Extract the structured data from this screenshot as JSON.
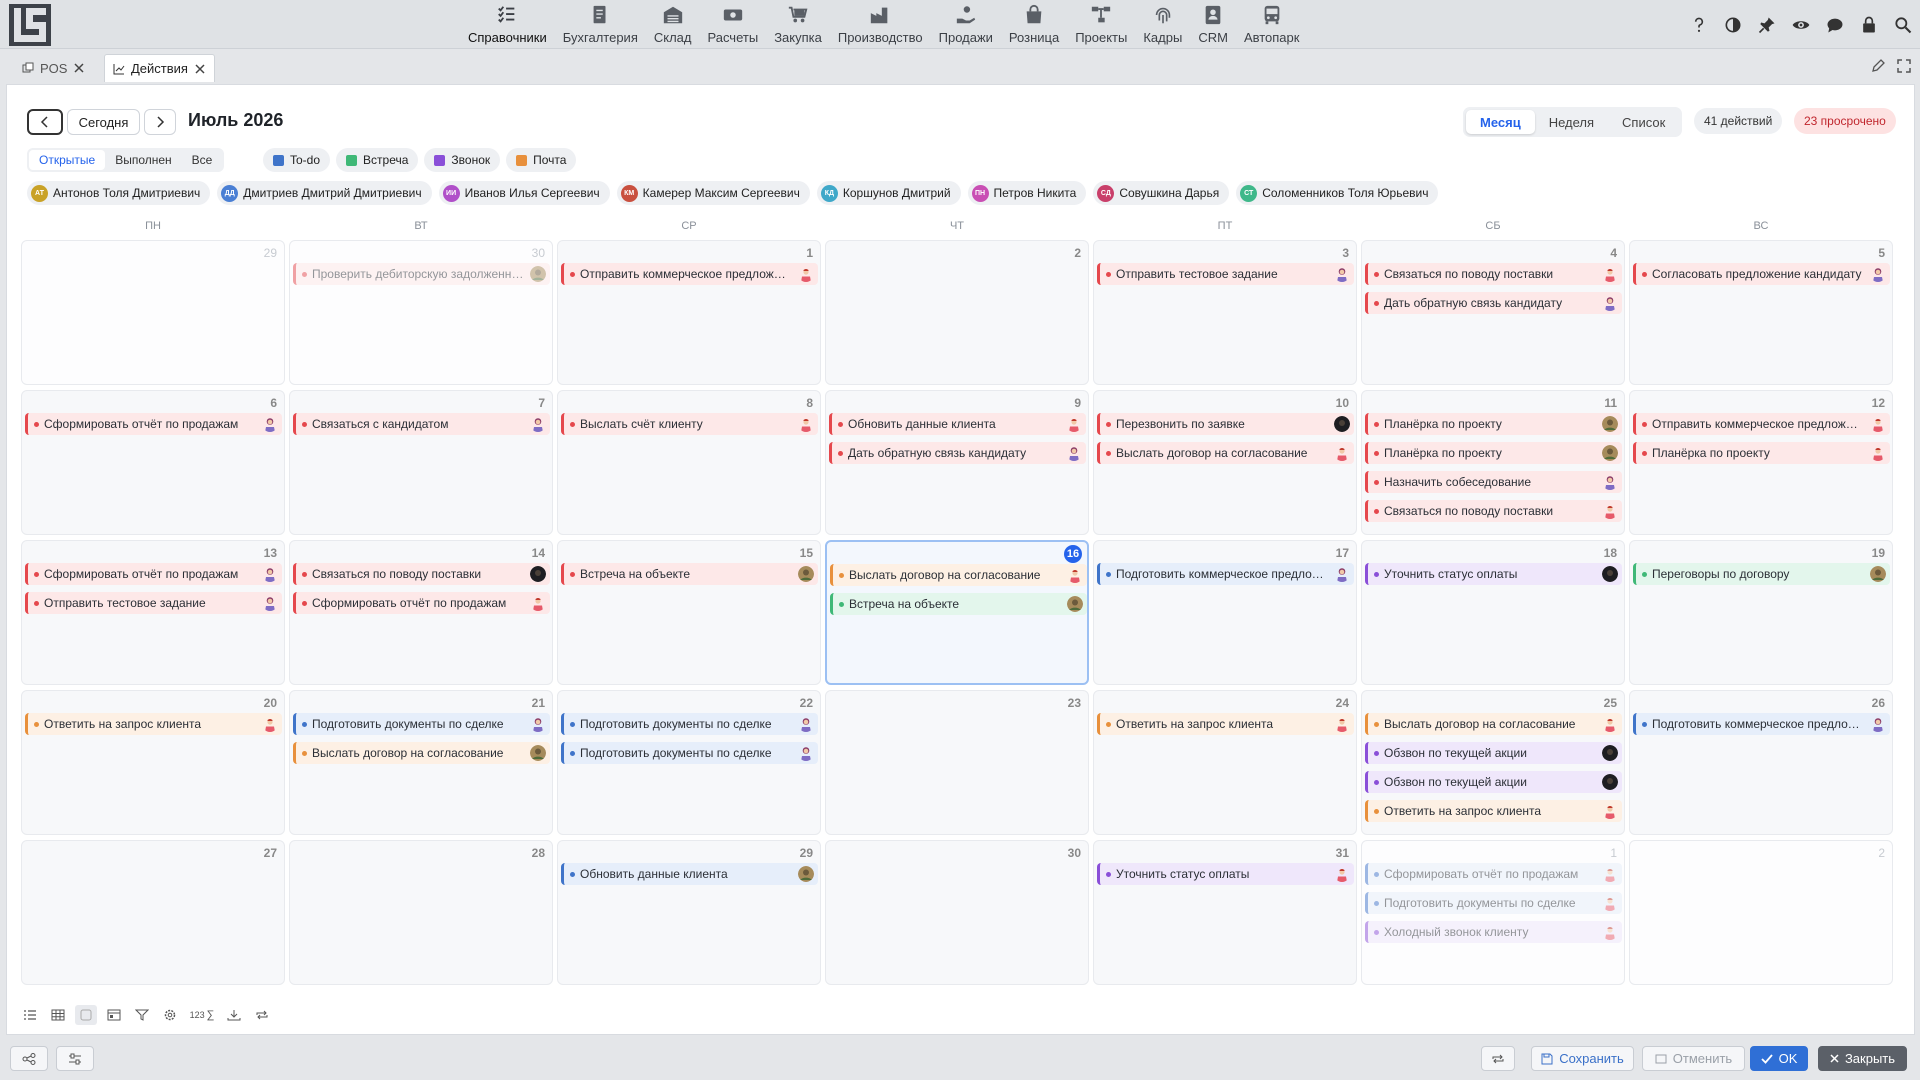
{
  "nav": [
    {
      "label": "Справочники",
      "icon": "list-check-icon"
    },
    {
      "label": "Бухгалтерия",
      "icon": "ledger-icon"
    },
    {
      "label": "Склад",
      "icon": "warehouse-icon"
    },
    {
      "label": "Расчеты",
      "icon": "money-icon"
    },
    {
      "label": "Закупка",
      "icon": "cart-icon"
    },
    {
      "label": "Производство",
      "icon": "factory-icon"
    },
    {
      "label": "Продажи",
      "icon": "hand-coin-icon"
    },
    {
      "label": "Розница",
      "icon": "shopping-bag-icon"
    },
    {
      "label": "Проекты",
      "icon": "project-tree-icon"
    },
    {
      "label": "Кадры",
      "icon": "fingerprint-icon"
    },
    {
      "label": "CRM",
      "icon": "contact-card-icon"
    },
    {
      "label": "Автопарк",
      "icon": "bus-icon"
    }
  ],
  "top_icons": [
    "help-icon",
    "theme-contrast-icon",
    "pin-icon",
    "eye-icon",
    "chat-icon",
    "lock-icon",
    "search-icon"
  ],
  "tabs": [
    {
      "label": "POS"
    },
    {
      "label": "Действия"
    }
  ],
  "toolbar": {
    "today": "Сегодня",
    "title": "Июль 2026"
  },
  "views": [
    "Месяц",
    "Неделя",
    "Список"
  ],
  "badges": {
    "count": "41 действий",
    "overdue": "23 просрочено"
  },
  "status_filters": [
    "Открытые",
    "Выполнен",
    "Все"
  ],
  "type_filters": [
    {
      "label": "To-do",
      "color": "#3f74c9"
    },
    {
      "label": "Встреча",
      "color": "#3fb877"
    },
    {
      "label": "Звонок",
      "color": "#8a4fd8"
    },
    {
      "label": "Почта",
      "color": "#e8903c"
    }
  ],
  "users": [
    {
      "initials": "АТ",
      "name": "Антонов Толя Дмитриевич",
      "color": "#c9a227"
    },
    {
      "initials": "ДД",
      "name": "Дмитриев Дмитрий Дмитриевич",
      "color": "#4a7fd4"
    },
    {
      "initials": "ИИ",
      "name": "Иванов Илья Сергеевич",
      "color": "#b04fc9"
    },
    {
      "initials": "КМ",
      "name": "Камерер Максим Сергеевич",
      "color": "#c9503f"
    },
    {
      "initials": "КД",
      "name": "Коршунов Дмитрий",
      "color": "#3fa8c9"
    },
    {
      "initials": "ПН",
      "name": "Петров Никита",
      "color": "#c94fb4"
    },
    {
      "initials": "СД",
      "name": "Совушкина Дарья",
      "color": "#c93f6a"
    },
    {
      "initials": "СТ",
      "name": "Соломенников Толя Юрьевич",
      "color": "#3fb88a"
    }
  ],
  "weekdays": [
    "ПН",
    "ВТ",
    "СР",
    "ЧТ",
    "ПТ",
    "СБ",
    "ВС"
  ],
  "days": [
    {
      "d": "29",
      "other": true,
      "ev": []
    },
    {
      "d": "30",
      "other": true,
      "ev": [
        {
          "t": "Проверить дебиторскую задолженность",
          "c": "red",
          "a": "photo",
          "f": true
        }
      ]
    },
    {
      "d": "1",
      "ev": [
        {
          "t": "Отправить коммерческое предложение",
          "c": "red",
          "a": "m"
        }
      ]
    },
    {
      "d": "2",
      "ev": []
    },
    {
      "d": "3",
      "ev": [
        {
          "t": "Отправить тестовое задание",
          "c": "red",
          "a": "w"
        }
      ]
    },
    {
      "d": "4",
      "ev": [
        {
          "t": "Связаться по поводу поставки",
          "c": "red",
          "a": "m"
        },
        {
          "t": "Дать обратную связь кандидату",
          "c": "red",
          "a": "w"
        }
      ]
    },
    {
      "d": "5",
      "ev": [
        {
          "t": "Согласовать предложение кандидату",
          "c": "red",
          "a": "w"
        }
      ]
    },
    {
      "d": "6",
      "ev": [
        {
          "t": "Сформировать отчёт по продажам",
          "c": "red",
          "a": "w"
        }
      ]
    },
    {
      "d": "7",
      "ev": [
        {
          "t": "Связаться с кандидатом",
          "c": "red",
          "a": "w"
        }
      ]
    },
    {
      "d": "8",
      "ev": [
        {
          "t": "Выслать счёт клиенту",
          "c": "red",
          "a": "m"
        }
      ]
    },
    {
      "d": "9",
      "ev": [
        {
          "t": "Обновить данные клиента",
          "c": "red",
          "a": "m"
        },
        {
          "t": "Дать обратную связь кандидату",
          "c": "red",
          "a": "w"
        }
      ]
    },
    {
      "d": "10",
      "ev": [
        {
          "t": "Перезвонить по заявке",
          "c": "red",
          "a": "dark"
        },
        {
          "t": "Выслать договор на согласование",
          "c": "red",
          "a": "m"
        }
      ]
    },
    {
      "d": "11",
      "ev": [
        {
          "t": "Планёрка по проекту",
          "c": "red",
          "a": "photo"
        },
        {
          "t": "Планёрка по проекту",
          "c": "red",
          "a": "photo"
        },
        {
          "t": "Назначить собеседование",
          "c": "red",
          "a": "w"
        },
        {
          "t": "Связаться по поводу поставки",
          "c": "red",
          "a": "m"
        }
      ]
    },
    {
      "d": "12",
      "ev": [
        {
          "t": "Отправить коммерческое предложение",
          "c": "red",
          "a": "m"
        },
        {
          "t": "Планёрка по проекту",
          "c": "red",
          "a": "m"
        }
      ]
    },
    {
      "d": "13",
      "ev": [
        {
          "t": "Сформировать отчёт по продажам",
          "c": "red",
          "a": "w"
        },
        {
          "t": "Отправить тестовое задание",
          "c": "red",
          "a": "w"
        }
      ]
    },
    {
      "d": "14",
      "ev": [
        {
          "t": "Связаться по поводу поставки",
          "c": "red",
          "a": "dark"
        },
        {
          "t": "Сформировать отчёт по продажам",
          "c": "red",
          "a": "m"
        }
      ]
    },
    {
      "d": "15",
      "ev": [
        {
          "t": "Встреча на объекте",
          "c": "red",
          "a": "photo"
        }
      ]
    },
    {
      "d": "16",
      "today": true,
      "ev": [
        {
          "t": "Выслать договор на согласование",
          "c": "orange",
          "a": "m"
        },
        {
          "t": "Встреча на объекте",
          "c": "green",
          "a": "photo"
        }
      ]
    },
    {
      "d": "17",
      "ev": [
        {
          "t": "Подготовить коммерческое предложение",
          "c": "blue",
          "a": "w"
        }
      ]
    },
    {
      "d": "18",
      "ev": [
        {
          "t": "Уточнить статус оплаты",
          "c": "purple",
          "a": "dark"
        }
      ]
    },
    {
      "d": "19",
      "ev": [
        {
          "t": "Переговоры по договору",
          "c": "green",
          "a": "photo"
        }
      ]
    },
    {
      "d": "20",
      "ev": [
        {
          "t": "Ответить на запрос клиента",
          "c": "orange",
          "a": "m"
        }
      ]
    },
    {
      "d": "21",
      "ev": [
        {
          "t": "Подготовить документы по сделке",
          "c": "blue",
          "a": "w"
        },
        {
          "t": "Выслать договор на согласование",
          "c": "orange",
          "a": "photo"
        }
      ]
    },
    {
      "d": "22",
      "ev": [
        {
          "t": "Подготовить документы по сделке",
          "c": "blue",
          "a": "w"
        },
        {
          "t": "Подготовить документы по сделке",
          "c": "blue",
          "a": "w"
        }
      ]
    },
    {
      "d": "23",
      "ev": []
    },
    {
      "d": "24",
      "ev": [
        {
          "t": "Ответить на запрос клиента",
          "c": "orange",
          "a": "m"
        }
      ]
    },
    {
      "d": "25",
      "ev": [
        {
          "t": "Выслать договор на согласование",
          "c": "orange",
          "a": "m"
        },
        {
          "t": "Обзвон по текущей акции",
          "c": "purple",
          "a": "dark"
        },
        {
          "t": "Обзвон по текущей акции",
          "c": "purple",
          "a": "dark"
        },
        {
          "t": "Ответить на запрос клиента",
          "c": "orange",
          "a": "m"
        }
      ]
    },
    {
      "d": "26",
      "ev": [
        {
          "t": "Подготовить коммерческое предложение",
          "c": "blue",
          "a": "w"
        }
      ]
    },
    {
      "d": "27",
      "ev": []
    },
    {
      "d": "28",
      "ev": []
    },
    {
      "d": "29",
      "ev": [
        {
          "t": "Обновить данные клиента",
          "c": "blue",
          "a": "photo"
        }
      ]
    },
    {
      "d": "30",
      "ev": []
    },
    {
      "d": "31",
      "ev": [
        {
          "t": "Уточнить статус оплаты",
          "c": "purple",
          "a": "m"
        }
      ]
    },
    {
      "d": "1",
      "other": true,
      "ev": [
        {
          "t": "Сформировать отчёт по продажам",
          "c": "blue",
          "a": "m",
          "f": true
        },
        {
          "t": "Подготовить документы по сделке",
          "c": "blue",
          "a": "m",
          "f": true
        },
        {
          "t": "Холодный звонок клиенту",
          "c": "purple",
          "a": "m",
          "f": true
        }
      ]
    },
    {
      "d": "2",
      "other": true,
      "ev": []
    }
  ],
  "bottom_tools": {
    "count_label": "123"
  },
  "footer": {
    "save": "Сохранить",
    "cancel": "Отменить",
    "ok": "OK",
    "close": "Закрыть"
  }
}
